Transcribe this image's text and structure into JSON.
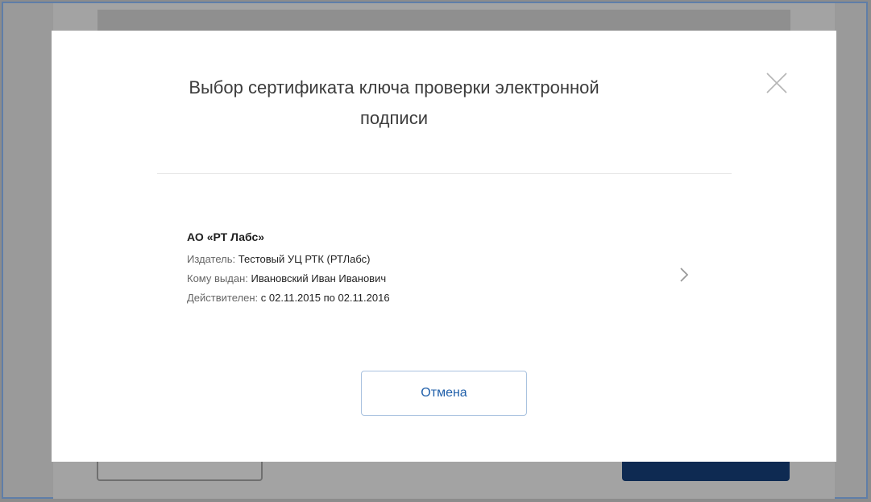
{
  "modal": {
    "title": "Выбор сертификата ключа проверки электронной подписи",
    "close_icon": "close-icon",
    "certificate": {
      "name": "АО «РТ Лабс»",
      "issuer_label": "Издатель:",
      "issuer_value": "Тестовый УЦ РТК (РТЛабс)",
      "owner_label": "Кому выдан:",
      "owner_value": "Ивановский Иван Иванович",
      "validity_label": "Действителен:",
      "validity_value": "с 02.11.2015 по 02.11.2016",
      "chevron_icon": "chevron-right-icon"
    },
    "cancel_label": "Отмена"
  },
  "colors": {
    "overlay": "#8c8c8c",
    "modal_bg": "#ffffff",
    "title_text": "#3c3c3c",
    "link_blue": "#1f5faa",
    "button_border": "#a9c2df",
    "primary_dark": "#0e2a52"
  }
}
